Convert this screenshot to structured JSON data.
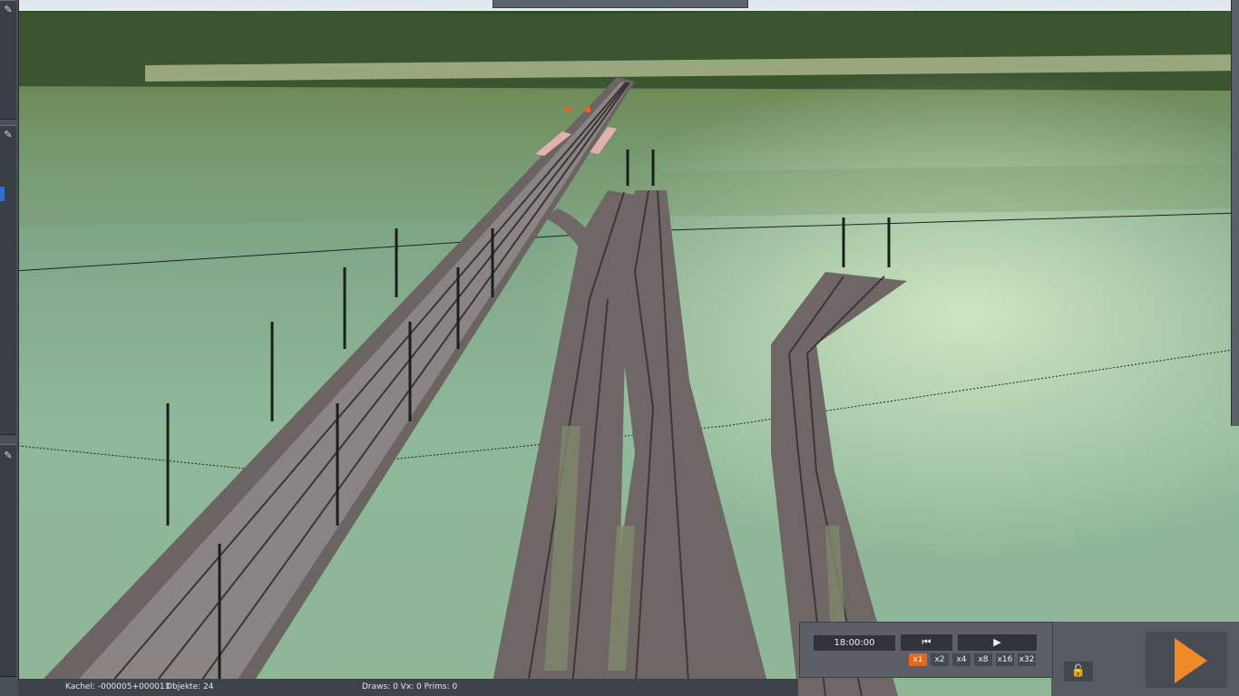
{
  "status": {
    "kachel": "Kachel: -000005+000013",
    "objekte": "Objekte: 24",
    "draws": "Draws: 0 Vx: 0 Prims: 0"
  },
  "controls": {
    "time": "18:00:00",
    "rewind_icon": "⏮",
    "play_icon": "▶",
    "speeds": [
      "x1",
      "x2",
      "x4",
      "x8",
      "x16",
      "x32"
    ],
    "active_speed": "x1",
    "lock_icon": "lock-open-icon",
    "big_play_icon": "play-icon"
  },
  "colors": {
    "accent": "#e4681d",
    "play": "#f08a28",
    "panel": "#5c6066"
  }
}
